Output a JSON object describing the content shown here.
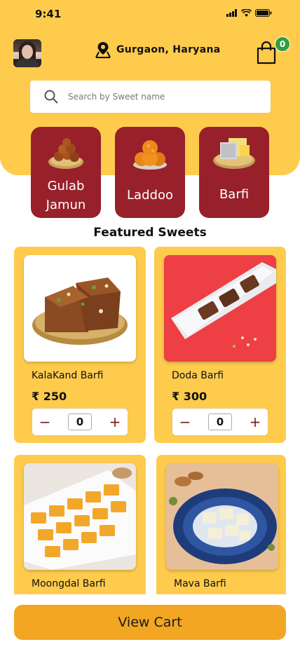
{
  "status_bar": {
    "time": "9:41"
  },
  "header": {
    "location": "Gurgaon, Haryana",
    "cart_count": "0"
  },
  "search": {
    "placeholder": "Search by Sweet name"
  },
  "categories": [
    {
      "label_line1": "Gulab",
      "label_line2": "Jamun"
    },
    {
      "label_line1": "Laddoo"
    },
    {
      "label_line1": "Barfi"
    }
  ],
  "featured": {
    "title": "Featured Sweets",
    "items": [
      {
        "name": "KalaKand Barfi",
        "price": "250",
        "currency": "₹",
        "qty": "0"
      },
      {
        "name": "Doda Barfi",
        "price": "300",
        "currency": "₹",
        "qty": "0"
      },
      {
        "name": "Moongdal Barfi"
      },
      {
        "name": "Mava Barfi"
      }
    ],
    "stepper": {
      "minus": "−",
      "plus": "+"
    }
  },
  "footer": {
    "view_cart_label": "View Cart"
  },
  "colors": {
    "header": "#FECB4D",
    "category": "#97202A",
    "button": "#F2A622",
    "badge": "#2e9e3f"
  }
}
